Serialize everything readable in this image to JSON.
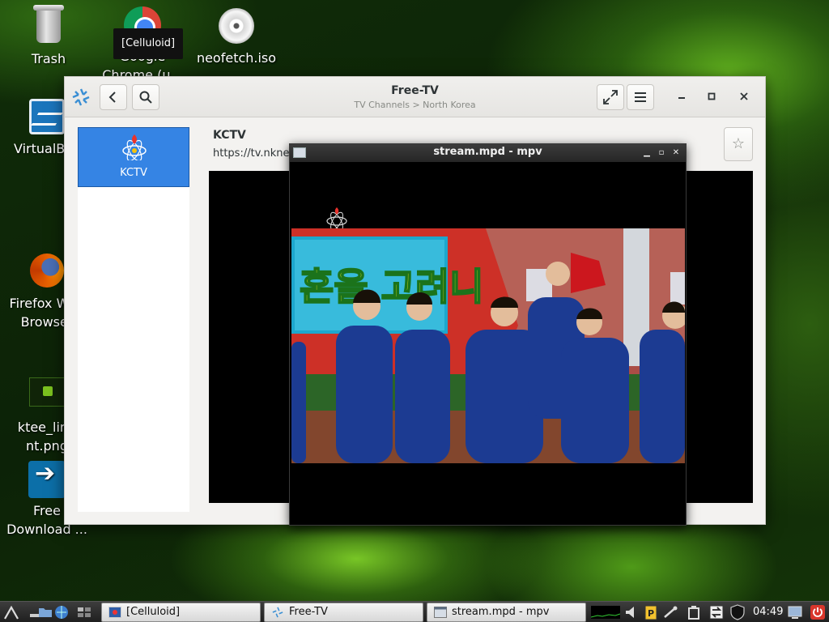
{
  "desktop": {
    "icons": [
      {
        "label": "Trash",
        "icon": "trash-icon"
      },
      {
        "label": "Google Chrome (u...",
        "icon": "chrome-icon"
      },
      {
        "label": "neofetch.iso",
        "icon": "disc-image-icon"
      },
      {
        "label": "VirtualBox",
        "icon": "virtualbox-icon"
      },
      {
        "label": "Firefox Web Browser",
        "icon": "firefox-icon"
      },
      {
        "label": "ktee_linux mint.png",
        "icon": "png-image-icon"
      },
      {
        "label": "Free Download ...",
        "icon": "free-download-manager-icon"
      }
    ],
    "icon_lines": {
      "chrome": [
        "Google",
        "Chrome (u..."
      ],
      "virtualbox": [
        "VirtualBox"
      ],
      "firefox": [
        "Firefox Web",
        "Browser"
      ],
      "png": [
        "ktee_linu",
        "nt.png"
      ],
      "fdm": [
        "Free",
        "Download ..."
      ]
    },
    "tooltip": "[Celluloid]"
  },
  "freetv_window": {
    "title": "Free-TV",
    "subtitle": "TV Channels > North Korea",
    "buttons": {
      "back": "back-icon",
      "search": "search-icon",
      "fullscreen": "fullscreen-icon",
      "menu": "hamburger-menu-icon",
      "minimize": "minimize-icon",
      "maximize": "maximize-icon",
      "close": "close-icon"
    },
    "sidebar": {
      "channels": [
        {
          "name": "KCTV",
          "selected": true
        }
      ]
    },
    "detail": {
      "channel_name": "KCTV",
      "url": "https://tv.nknews",
      "favorite": "star-icon"
    }
  },
  "mpv_window": {
    "title": "stream.mpd - mpv",
    "video_text": "혼을 고려니"
  },
  "taskbar": {
    "tasks": [
      {
        "label": "[Celluloid]",
        "icon": "celluloid-icon",
        "active": true
      },
      {
        "label": "Free-TV",
        "icon": "freetv-icon",
        "active": false
      },
      {
        "label": "stream.mpd - mpv",
        "icon": "mpv-icon",
        "active": false
      }
    ],
    "clock": "04:49",
    "colors": {
      "accent": "#3584e4",
      "panel": "#2b2b2b"
    }
  }
}
